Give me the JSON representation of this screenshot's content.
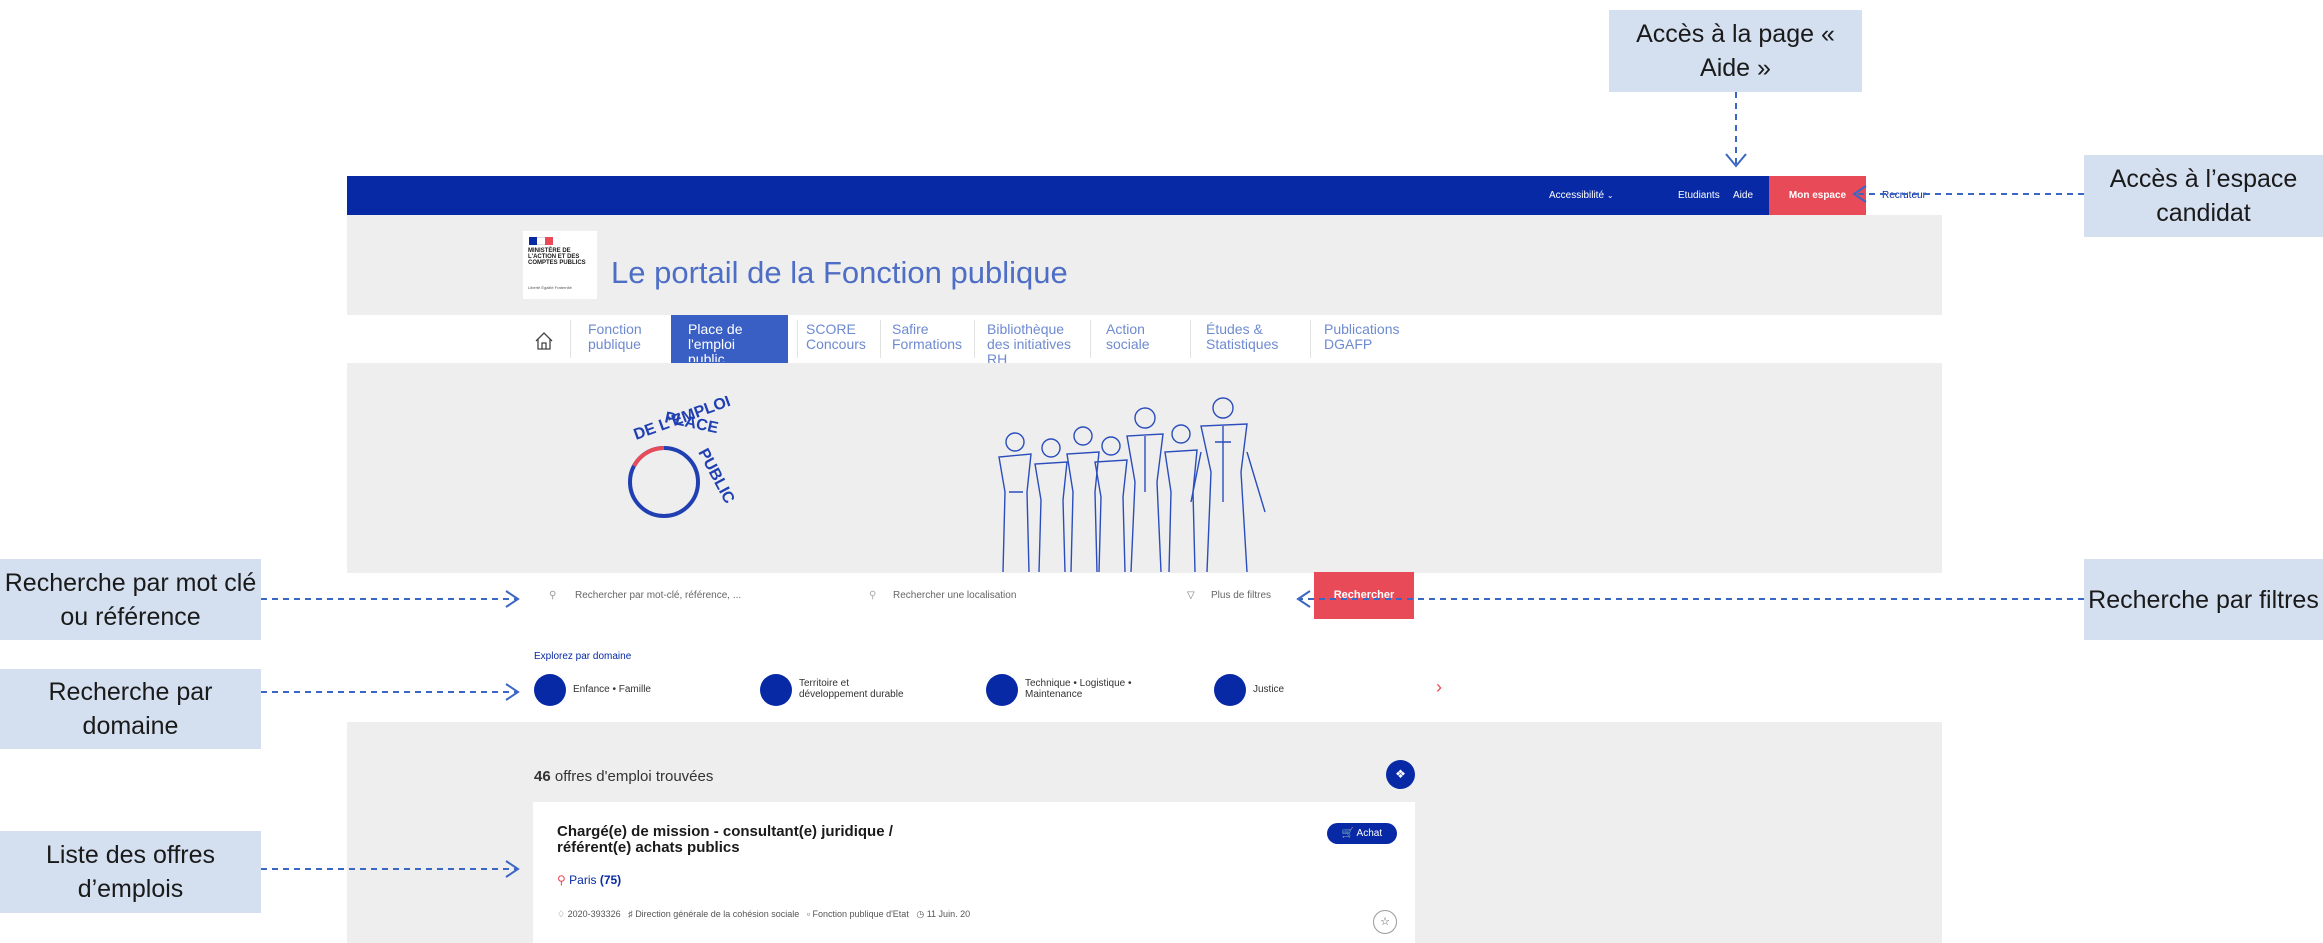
{
  "annotations": {
    "aide": "Accès à la page « Aide »",
    "espace": "Accès à l’espace candidat",
    "mot_cle": "Recherche par mot clé ou référence",
    "filtres": "Recherche par filtres",
    "domaine": "Recherche par domaine",
    "liste": "Liste des offres d’emplois"
  },
  "topbar": {
    "accessibilite": "Accessibilité",
    "etudiants": "Etudiants",
    "aide": "Aide",
    "mon_espace": "Mon espace",
    "recruteur": "Recruteur"
  },
  "header": {
    "logo_text": "MINISTÈRE DE L'ACTION ET DES COMPTES PUBLICS",
    "logo_motto": "Liberté Égalité Fraternité",
    "title": "Le portail de la Fonction publique"
  },
  "nav": {
    "items": [
      "Fonction publique",
      "Place de l'emploi public",
      "SCORE Concours",
      "Safire Formations",
      "Bibliothèque des initiatives RH",
      "Action sociale",
      "Études & Statistiques",
      "Publications DGAFP"
    ]
  },
  "hero": {
    "logo_top": "PLACE",
    "logo_mid": "DE L'EMPLOI",
    "logo_bottom": "PUBLIC"
  },
  "search": {
    "keyword_placeholder": "Rechercher par mot-clé, référence, ...",
    "location_placeholder": "Rechercher une localisation",
    "filters": "Plus de filtres",
    "button": "Rechercher"
  },
  "domains": {
    "heading": "Explorez par domaine",
    "items": [
      "Enfance • Famille",
      "Territoire et développement durable",
      "Technique • Logistique • Maintenance",
      "Justice"
    ]
  },
  "results": {
    "count": "46",
    "count_label": "offres d'emploi trouvées"
  },
  "offer": {
    "title": "Chargé(e) de mission - consultant(e) juridique / référent(e) achats publics",
    "badge": "Achat",
    "city": "Paris",
    "dept": "(75)",
    "reference": "2020-393326",
    "organisation": "Direction générale de la cohésion sociale",
    "fonction": "Fonction publique d'Etat",
    "date": "11 Juin. 20"
  },
  "colors": {
    "brand_blue": "#0729a6",
    "accent_red": "#e94a57",
    "callout_bg": "#d4dff0",
    "arrow": "#3a66c4"
  }
}
